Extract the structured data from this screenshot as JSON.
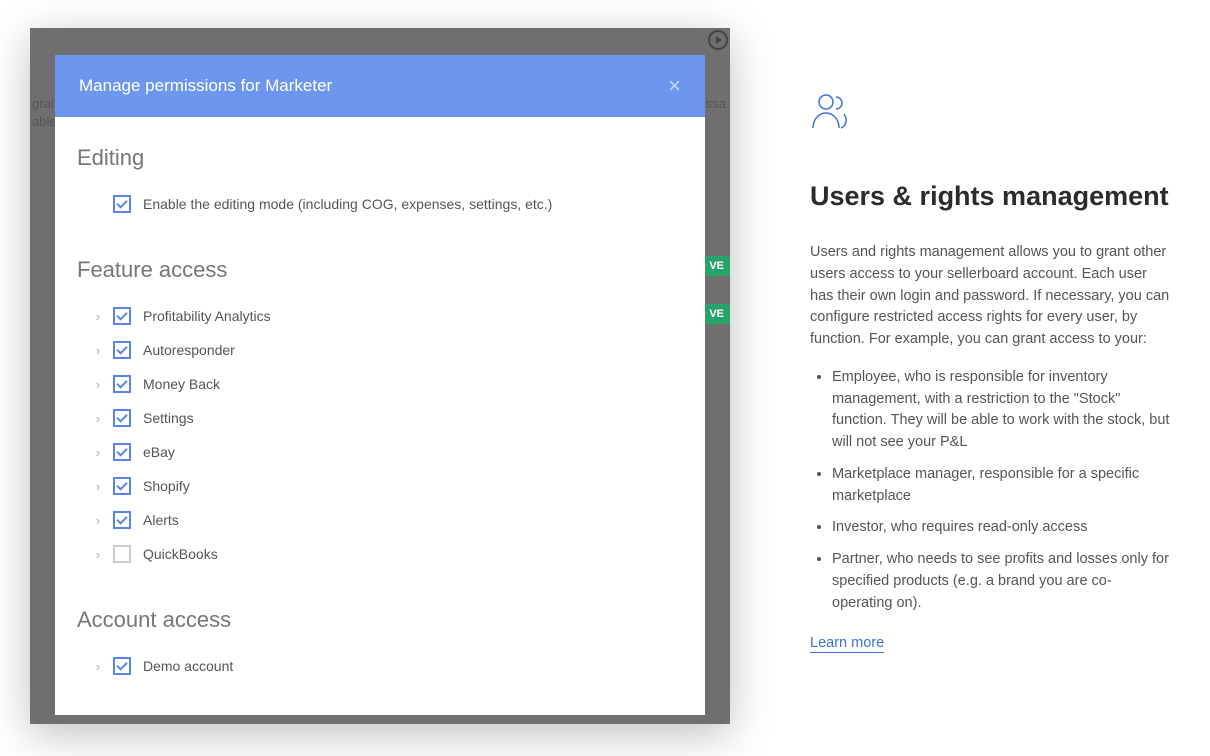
{
  "modal": {
    "title": "Manage permissions for Marketer",
    "sections": {
      "editing": {
        "heading": "Editing",
        "option_label": "Enable the editing mode (including COG, expenses, settings, etc.)"
      },
      "feature_access": {
        "heading": "Feature access",
        "items": [
          {
            "label": "Profitability Analytics",
            "checked": true
          },
          {
            "label": "Autoresponder",
            "checked": true
          },
          {
            "label": "Money Back",
            "checked": true
          },
          {
            "label": "Settings",
            "checked": true
          },
          {
            "label": "eBay",
            "checked": true
          },
          {
            "label": "Shopify",
            "checked": true
          },
          {
            "label": "Alerts",
            "checked": true
          },
          {
            "label": "QuickBooks",
            "checked": false
          }
        ]
      },
      "account_access": {
        "heading": "Account access",
        "items": [
          {
            "label": "Demo account",
            "checked": true
          }
        ]
      }
    }
  },
  "background": {
    "text_frag_1": "grai",
    "text_frag_2": "able",
    "text_frag_3": "essa",
    "badge_text": "VE"
  },
  "right": {
    "title": "Users & rights management",
    "paragraph": "Users and rights management allows you to grant other users access to your sellerboard account. Each user has their own login and password. If necessary, you can configure restricted access rights for every user, by function. For example, you can grant access to your:",
    "bullets": [
      "Employee, who is responsible for inventory management, with a restriction to the \"Stock\" function. They will be able to work with the stock, but will not see your P&L",
      "Marketplace manager, responsible for a specific marketplace",
      "Investor, who requires read-only access",
      "Partner, who needs to see profits and losses only for specified products (e.g. a brand you are co-operating on)."
    ],
    "learn_more": "Learn more"
  }
}
